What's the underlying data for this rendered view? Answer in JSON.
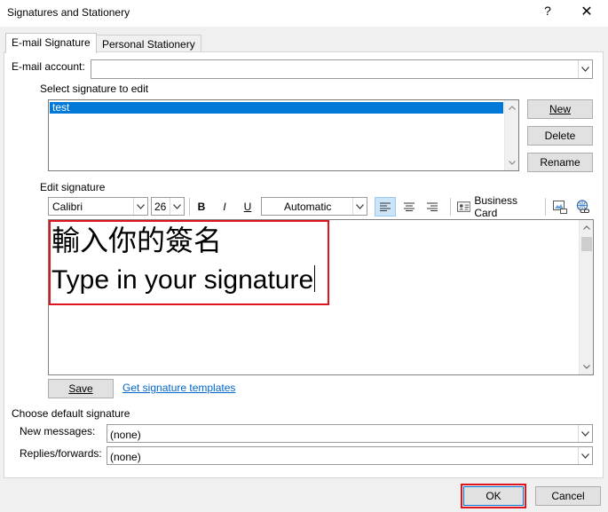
{
  "window": {
    "title": "Signatures and Stationery",
    "help_glyph": "?",
    "close_glyph": "✕"
  },
  "tabs": [
    {
      "label": "E-mail Signature",
      "active": true
    },
    {
      "label": "Personal Stationery",
      "active": false
    }
  ],
  "email_account": {
    "label": "E-mail account:",
    "value": ""
  },
  "select_signature": {
    "label": "Select signature to edit",
    "items": [
      "test"
    ],
    "selected_index": 0
  },
  "signature_buttons": {
    "new": "New",
    "delete": "Delete",
    "rename": "Rename"
  },
  "edit_signature": {
    "label": "Edit signature",
    "font": "Calibri",
    "size": "26",
    "bold": "B",
    "italic": "I",
    "underline": "U",
    "color": "Automatic",
    "business_card": "Business Card",
    "content": {
      "line1": "輸入你的簽名",
      "line2": "Type in your signature"
    }
  },
  "save_label": "Save",
  "templates_link": "Get signature templates",
  "default_signature": {
    "label": "Choose default signature",
    "new_messages_label": "New messages:",
    "new_messages_value": "(none)",
    "replies_label": "Replies/forwards:",
    "replies_value": "(none)"
  },
  "footer": {
    "ok": "OK",
    "cancel": "Cancel"
  },
  "colors": {
    "selection": "#0078d7",
    "highlight_box": "#e0141e",
    "link": "#0066cc"
  }
}
